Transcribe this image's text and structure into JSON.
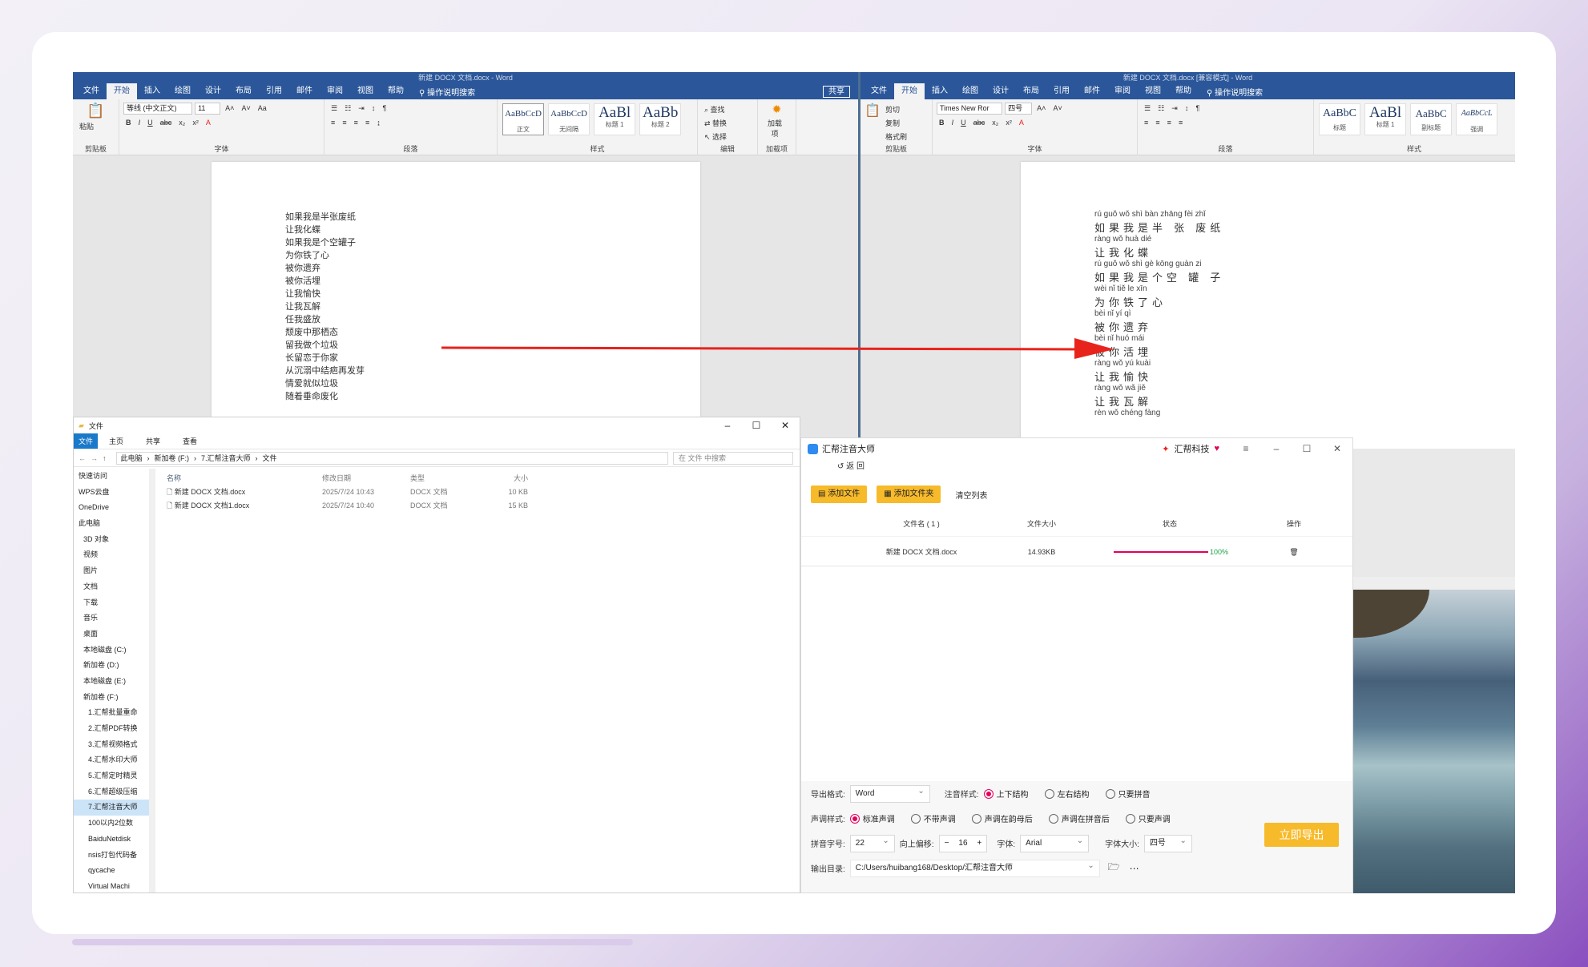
{
  "word_left": {
    "title": "新建 DOCX 文档.docx - Word",
    "tabs": [
      "文件",
      "开始",
      "插入",
      "绘图",
      "设计",
      "布局",
      "引用",
      "邮件",
      "审阅",
      "视图",
      "帮助"
    ],
    "tell_me": "操作说明搜索",
    "share": "共享",
    "clipboard": {
      "paste": "粘贴",
      "label": "剪贴板"
    },
    "font": {
      "name": "等线 (中文正文)",
      "size": "11",
      "label": "字体"
    },
    "paragraph_label": "段落",
    "styles": [
      {
        "sample": "AaBbCcD",
        "name": "正文"
      },
      {
        "sample": "AaBbCcD",
        "name": "无间隔"
      },
      {
        "sample": "AaBl",
        "name": "标题 1"
      },
      {
        "sample": "AaBb",
        "name": "标题 2"
      }
    ],
    "styles_label": "样式",
    "editing": {
      "find": "查找",
      "replace": "替换",
      "select": "选择",
      "label": "编辑"
    },
    "addin": {
      "name": "加载项",
      "label": "加载项"
    },
    "poem": [
      "如果我是半张废纸",
      "让我化蝶",
      "如果我是个空罐子",
      "为你铁了心",
      "被你遗弃",
      "被你活埋",
      "让我愉快",
      "让我瓦解",
      "任我盛放",
      "颓废中那栖态",
      "留我做个垃圾",
      "长留恋于你家",
      "从沉溺中结疤再发芽",
      "情爱就似垃圾",
      "随着垂命废化"
    ]
  },
  "word_right": {
    "title": "新建 DOCX 文档.docx [兼容模式] - Word",
    "tabs": [
      "文件",
      "开始",
      "插入",
      "绘图",
      "设计",
      "布局",
      "引用",
      "邮件",
      "审阅",
      "视图",
      "帮助"
    ],
    "tell_me": "操作说明搜索",
    "clipboard": {
      "paste": "粘贴",
      "cut": "剪切",
      "copy": "复制",
      "format": "格式刷",
      "label": "剪贴板"
    },
    "font": {
      "name": "Times New Ror",
      "size": "四号",
      "label": "字体"
    },
    "paragraph_label": "段落",
    "styles": [
      {
        "sample": "AaBbC",
        "name": "标题"
      },
      {
        "sample": "AaBl",
        "name": "标题 1"
      },
      {
        "sample": "AaBbC",
        "name": "副标题"
      },
      {
        "sample": "AaBbCcL",
        "name": "强调"
      }
    ],
    "styles_label": "样式",
    "lines": [
      {
        "pinyin": "rú guǒ wǒ shì bàn zhāng fèi zhǐ",
        "hanzi": "如果我是半 张 废纸"
      },
      {
        "pinyin": "ràng wǒ huà dié",
        "hanzi": "让我化蝶"
      },
      {
        "pinyin": "rú guǒ wǒ shì gè kōng guàn zi",
        "hanzi": "如果我是个空 罐 子"
      },
      {
        "pinyin": "wèi nǐ tiě le xīn",
        "hanzi": "为你铁了心"
      },
      {
        "pinyin": "bèi nǐ yí qì",
        "hanzi": "被你遗弃"
      },
      {
        "pinyin": "bèi nǐ huó mái",
        "hanzi": "被你活埋"
      },
      {
        "pinyin": "ràng wǒ yú kuài",
        "hanzi": "让我愉快"
      },
      {
        "pinyin": "ràng wǒ wǎ jiě",
        "hanzi": "让我瓦解"
      },
      {
        "pinyin": "rèn wǒ chéng fàng",
        "hanzi": ""
      }
    ]
  },
  "explorer": {
    "title": "文件",
    "ribbon": [
      "文件",
      "主页",
      "共享",
      "查看"
    ],
    "path": [
      "此电脑",
      "新加卷 (F:)",
      "7.汇帮注音大师",
      "文件"
    ],
    "search_placeholder": "在 文件 中搜索",
    "nav": [
      "快速访问",
      "WPS云盘",
      "OneDrive",
      "此电脑",
      "3D 对象",
      "视频",
      "图片",
      "文档",
      "下载",
      "音乐",
      "桌面",
      "本地磁盘 (C:)",
      "新加卷 (D:)",
      "本地磁盘 (E:)",
      "新加卷 (F:)",
      "1.汇帮批量重命",
      "2.汇帮PDF转换",
      "3.汇帮视频格式",
      "4.汇帮水印大师",
      "5.汇帮定时精灵",
      "6.汇帮超级压缩",
      "7.汇帮注音大师",
      "100以内2位数",
      "BaiduNetdisk",
      "nsis打包代码备",
      "qycache",
      "Virtual Machi"
    ],
    "selected_nav": "7.汇帮注音大师",
    "columns": [
      "名称",
      "修改日期",
      "类型",
      "大小"
    ],
    "files": [
      {
        "name": "新建 DOCX 文档.docx",
        "date": "2025/7/24 10:43",
        "type": "DOCX 文档",
        "size": "10 KB"
      },
      {
        "name": "新建 DOCX 文档1.docx",
        "date": "2025/7/24 10:40",
        "type": "DOCX 文档",
        "size": "15 KB"
      }
    ]
  },
  "app": {
    "title": "汇帮注音大师",
    "brand": "汇帮科技",
    "back": "返 回",
    "add_file": "添加文件",
    "add_folder": "添加文件夹",
    "clear": "清空列表",
    "columns": {
      "name": "文件名 ( 1 )",
      "size": "文件大小",
      "status": "状态",
      "op": "操作"
    },
    "row": {
      "name": "新建 DOCX 文档.docx",
      "size": "14.93KB",
      "progress": 1.0,
      "percent": "100%"
    },
    "export_format": {
      "label": "导出格式:",
      "value": "Word"
    },
    "annotation_style": {
      "label": "注音样式:",
      "options": [
        "上下结构",
        "左右结构",
        "只要拼音"
      ],
      "selected": 0
    },
    "tone_style": {
      "label": "声调样式:",
      "options": [
        "标准声调",
        "不带声调",
        "声调在韵母后",
        "声调在拼音后",
        "只要声调"
      ],
      "selected": 0
    },
    "pinyin_size": {
      "label": "拼音字号:",
      "value": "22"
    },
    "offset": {
      "label": "向上偏移:",
      "value": "16",
      "minus": "−",
      "plus": "+"
    },
    "font": {
      "label": "字体:",
      "value": "Arial"
    },
    "font_size": {
      "label": "字体大小:",
      "value": "四号"
    },
    "output_dir": {
      "label": "输出目录:",
      "value": "C:/Users/huibang168/Desktop/汇帮注音大师"
    },
    "export_button": "立即导出"
  },
  "colors": {
    "word_blue": "#2b579a",
    "accent_yellow": "#f7ba2a",
    "radio_pink": "#e6005c",
    "progress_green": "#1aa34a",
    "arrow_red": "#e8231c"
  }
}
